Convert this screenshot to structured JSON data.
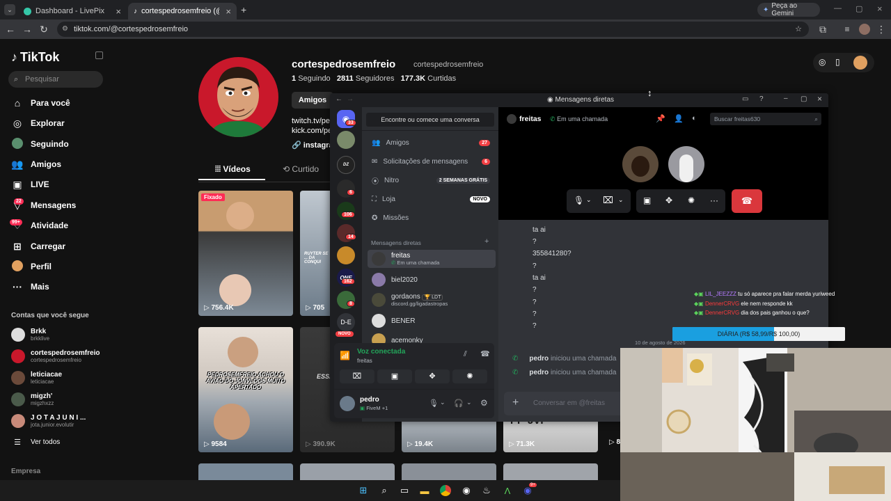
{
  "browser": {
    "tabs": [
      {
        "title": "Dashboard - LivePix"
      },
      {
        "title": "cortespedrosemfreio (@cortesp"
      }
    ],
    "url": "tiktok.com/@cortespedrosemfreio",
    "gemini_label": "Peça ao Gemini"
  },
  "tiktok": {
    "logo": "TikTok",
    "search_placeholder": "Pesquisar",
    "nav": [
      {
        "label": "Para você",
        "icon": "home-icon"
      },
      {
        "label": "Explorar",
        "icon": "compass-icon"
      },
      {
        "label": "Seguindo",
        "icon": "following-avatar-icon"
      },
      {
        "label": "Amigos",
        "icon": "friends-icon"
      },
      {
        "label": "LIVE",
        "icon": "live-icon"
      },
      {
        "label": "Mensagens",
        "icon": "messages-icon",
        "badge": "22"
      },
      {
        "label": "Atividade",
        "icon": "activity-icon",
        "badge": "99+"
      },
      {
        "label": "Carregar",
        "icon": "upload-icon"
      },
      {
        "label": "Perfil",
        "icon": "profile-icon"
      },
      {
        "label": "Mais",
        "icon": "more-icon"
      }
    ],
    "following_title": "Contas que você segue",
    "following": [
      {
        "name": "Brkk",
        "handle": "brkklive"
      },
      {
        "name": "cortespedrosemfreio",
        "handle": "cortespedrosemfreio"
      },
      {
        "name": "leticiacae",
        "handle": "leticiacae"
      },
      {
        "name": "migzh'",
        "handle": "migzhxzz"
      },
      {
        "name": "J O T A J U N I ...",
        "handle": "jota.junior.evolutir"
      }
    ],
    "see_all": "Ver todos",
    "company": "Empresa",
    "profile": {
      "username": "cortespedrosemfreio",
      "nickname": "cortespedrosemfreio",
      "following_count": "1",
      "following_label": "Seguindo",
      "followers_count": "2811",
      "followers_label": "Seguidores",
      "likes_count": "177.3K",
      "likes_label": "Curtidas",
      "friends_button": "Amigos",
      "bio_line1": "twitch.tv/pe",
      "bio_line2": "kick.com/pe",
      "bio_link": "instagra"
    },
    "tabs": {
      "videos": "Vídeos",
      "liked": "Curtido"
    },
    "pinned_label": "Fixado",
    "videos": [
      {
        "views": "756.4K"
      },
      {
        "views": "705"
      },
      {
        "views": "9584"
      },
      {
        "views": "390.9K"
      },
      {
        "views": "19.4K"
      },
      {
        "views": "71.3K"
      }
    ],
    "tile_captions": {
      "t2": "RUYTER SE ... DA CONQUI",
      "t3": "PEDROSEMFREIO ACHOU O AVIÃO DO JONVLOGS MUITO APERTADO",
      "t4": "ESSA",
      "t6": "PP-JVI"
    }
  },
  "discord": {
    "window_title": "Mensagens diretas",
    "search_placeholder": "Encontre ou comece uma conversa",
    "menu": [
      {
        "label": "Amigos",
        "badge": "27"
      },
      {
        "label": "Solicitações de mensagens",
        "badge": "6"
      },
      {
        "label": "Nitro",
        "pill": "2 SEMANAS GRÁTIS"
      },
      {
        "label": "Loja",
        "pill": "NOVO"
      },
      {
        "label": "Missões"
      }
    ],
    "dm_header": "Mensagens diretas",
    "dms": [
      {
        "name": "freitas",
        "sub": "Em uma chamada"
      },
      {
        "name": "biel2020",
        "sub": ""
      },
      {
        "name": "gordaons",
        "tag": "LDT",
        "sub": "discord.gg/ligadastropas"
      },
      {
        "name": "BENER",
        "sub": ""
      },
      {
        "name": "acemonky",
        "sub": ""
      }
    ],
    "guild_badges": [
      "33",
      "6",
      "106",
      "14",
      "162",
      "8"
    ],
    "guild_labels": {
      "de": "D-E",
      "novo": "NOVO"
    },
    "voice": {
      "status": "Voz conectada",
      "channel": "freitas"
    },
    "user": {
      "name": "pedro",
      "status": "FiveM +1"
    },
    "chat": {
      "name": "freitas",
      "status": "Em uma chamada",
      "search_placeholder": "Buscar freitas630",
      "messages": [
        "ta ai",
        "?",
        "355841280?",
        "?",
        "ta ai",
        "?",
        "?",
        "?",
        "?"
      ],
      "date_divider": "10 de agosto de 2026",
      "calls": [
        {
          "user": "pedro",
          "text": "iniciou uma chamada"
        },
        {
          "user": "pedro",
          "text": "iniciou uma chamada"
        }
      ],
      "input_placeholder": "Conversar em @freitas"
    }
  },
  "stream_overlay": {
    "chat": [
      {
        "user": "LIL_JEEZZZ",
        "text": "tu só aparece pra falar merda yuriweed",
        "color": "#b57cff"
      },
      {
        "user": "DennerCRVG",
        "text": "ele nem responde kk",
        "color": "#ff3b3b"
      },
      {
        "user": "DennerCRVG",
        "text": "dia dos pais ganhou o que?",
        "color": "#ff3b3b"
      }
    ],
    "goal_label": "DIÁRIA (R$ 58,99/R$ 100,00)",
    "goal_fraction": 0.5899
  },
  "taskbar": {
    "discord_badge": "9+"
  },
  "colors": {
    "tiktok_pink": "#fe2c55",
    "discord_blurple": "#5865f2",
    "discord_green": "#23a55a",
    "discord_red": "#da373c",
    "goal_blue": "#1a9fe0"
  }
}
